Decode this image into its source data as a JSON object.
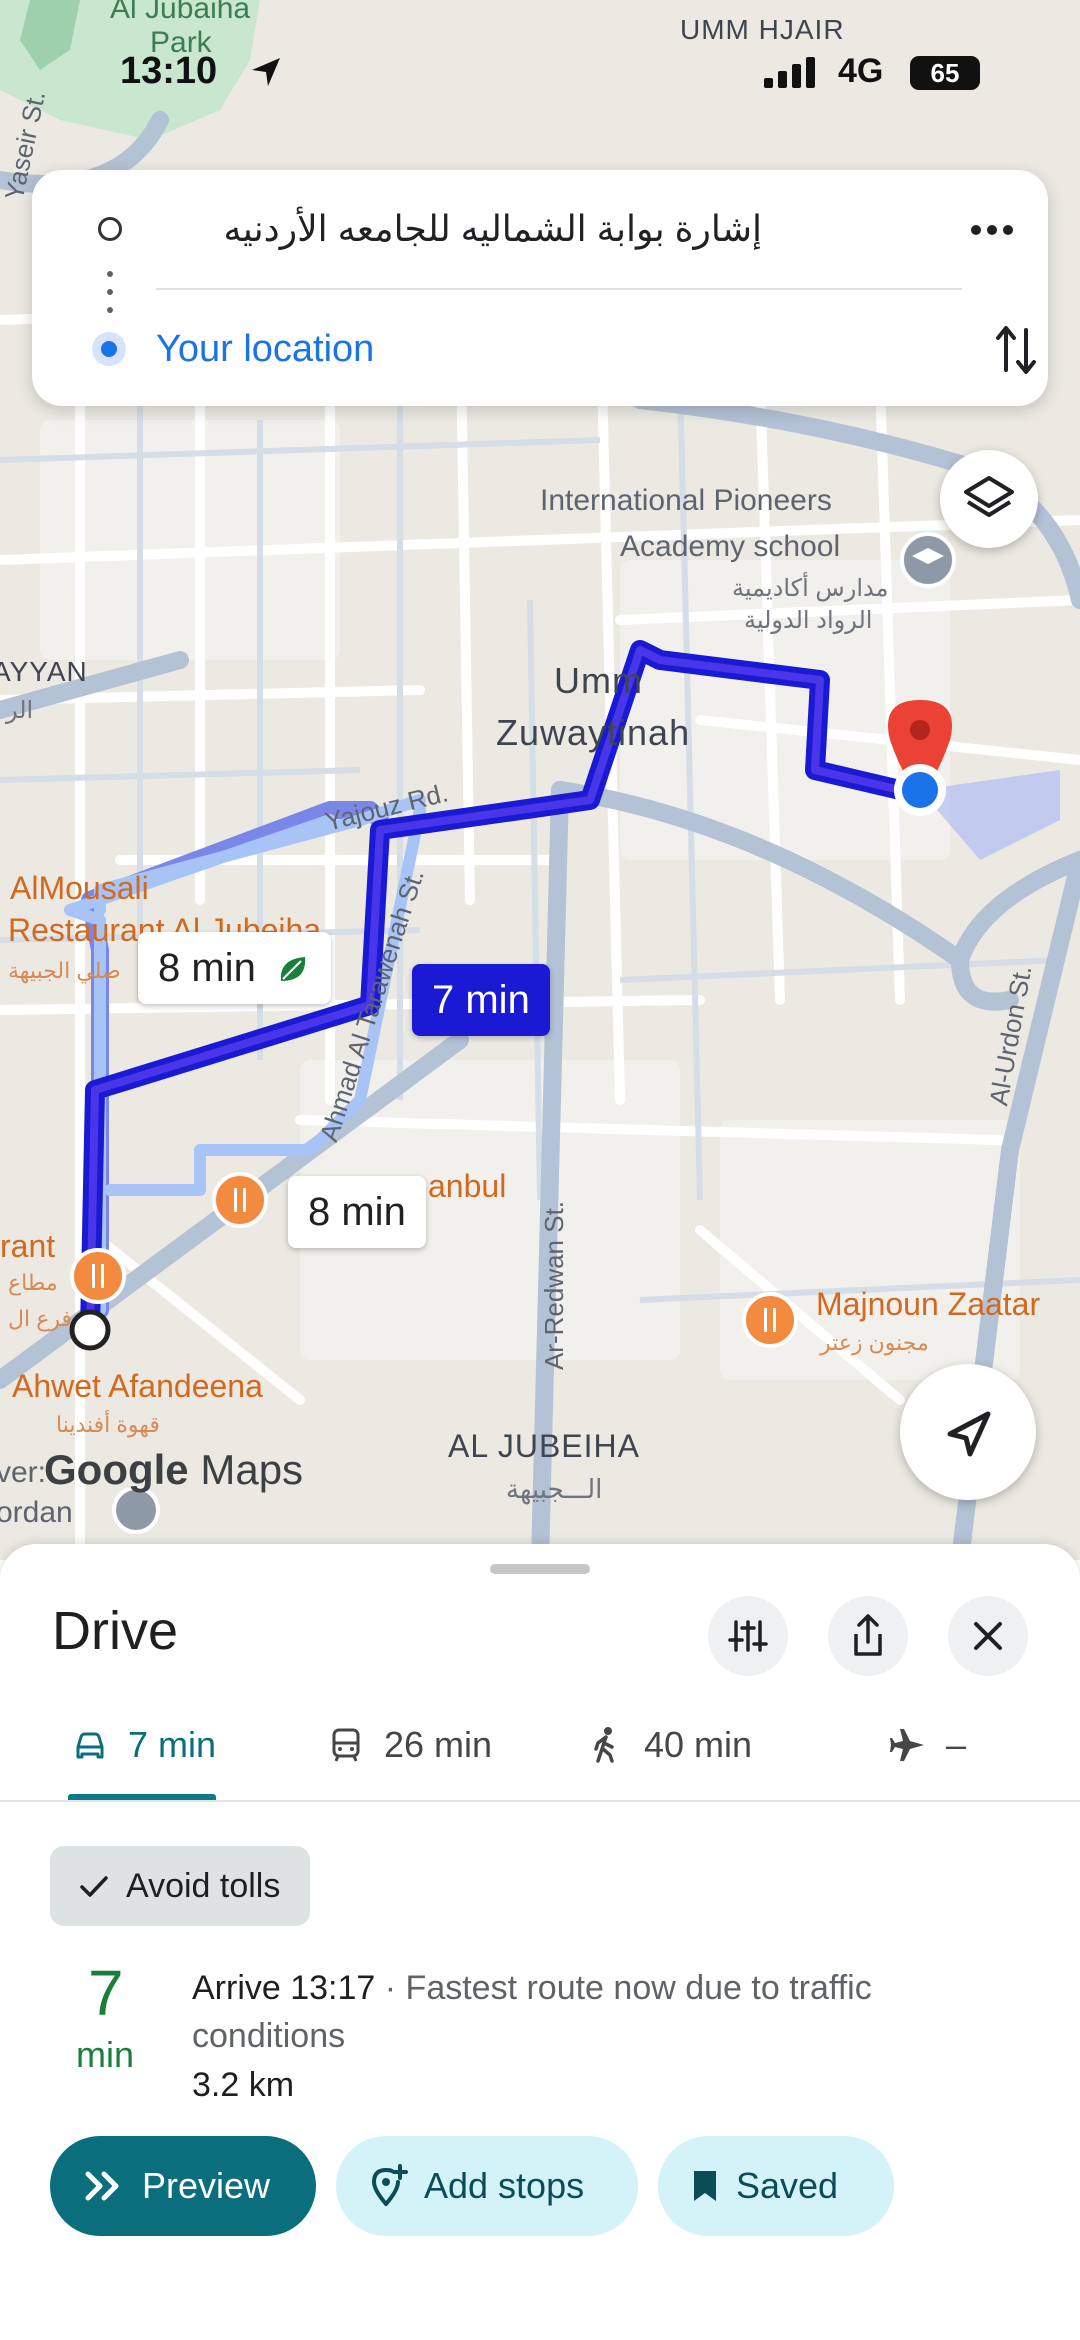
{
  "status_bar": {
    "time": "13:10",
    "network": "4G",
    "battery": "65"
  },
  "search": {
    "origin": "إشارة بوابة الشماليه للجامعه الأردنيه",
    "destination": "Your location"
  },
  "map": {
    "labels": {
      "umm_hjair": "UMM HJAIR",
      "al_jubaiha_park_1": "Al Jubaiha",
      "al_jubaiha_park_2": "Park",
      "yassir_st": "Yaseir St.",
      "school_1": "International Pioneers",
      "school_2": "Academy school",
      "school_ar_1": "مدارس أكاديمية",
      "school_ar_2": "الرواد الدولية",
      "rayyan": "AYYAN",
      "rayyan_ar": "الر",
      "umm_zuwaytinah_1": "Umm",
      "umm_zuwaytinah_2": "Zuwaytinah",
      "yajouz_rd": "Yajouz Rd.",
      "ahmad_st": "Ahmad Al Tarawenah St.",
      "almousali_1": "AlMousali",
      "almousali_2": "Restaurant Al Jubeiha",
      "almousali_ar": "صلي الجبيهة",
      "anbul": "anbul",
      "rant": "rant",
      "rant_ar_1": "مطاع",
      "rant_ar_2": "فرع ال",
      "ahwet": "Ahwet Afandeena",
      "ahwet_ar": "قهوة أفندينا",
      "ar_redwan": "Ar-Redwan St.",
      "majnoun": "Majnoun Zaatar",
      "majnoun_ar": "مجنون زعتر",
      "al_jubeiha": "AL JUBEIHA",
      "al_jubeiha_ar": "الـــجبيهة",
      "al_urdon": "Al-Urdon St.",
      "ver": "ver:",
      "ordan": "ordan"
    },
    "routes": [
      {
        "label": "8 min",
        "eco": true
      },
      {
        "label": "7 min",
        "selected": true
      },
      {
        "label": "8 min"
      }
    ],
    "logo_google": "Google",
    "logo_maps": "Maps"
  },
  "sheet": {
    "title": "Drive",
    "tabs": [
      {
        "label": "7 min",
        "icon": "car-icon",
        "active": true
      },
      {
        "label": "26 min",
        "icon": "transit-icon"
      },
      {
        "label": "40 min",
        "icon": "walk-icon"
      },
      {
        "label": "–",
        "icon": "flight-icon"
      }
    ],
    "avoid_tolls": "Avoid tolls",
    "eta_value": "7",
    "eta_unit": "min",
    "arrive": "Arrive 13:17",
    "arrive_sep": " · ",
    "arrive_note": "Fastest route now due to traffic conditions",
    "distance": "3.2 km",
    "buttons": {
      "preview": "Preview",
      "add_stops": "Add stops",
      "saved": "Saved"
    }
  },
  "colors": {
    "route_selected": "#1a1ad4",
    "route_alt": "#a8c3f5",
    "accent": "#0b6e7d",
    "eta": "#188038",
    "link_blue": "#1a73e8"
  }
}
